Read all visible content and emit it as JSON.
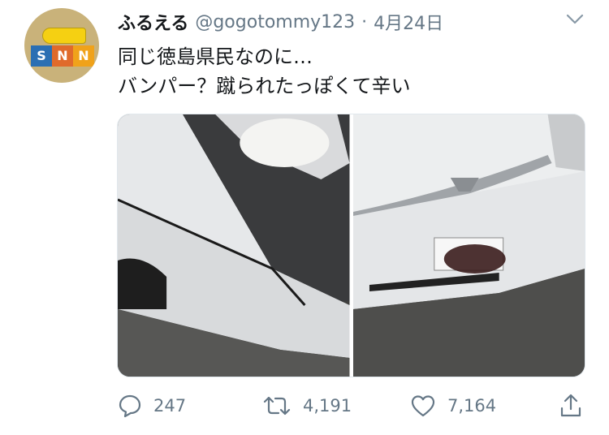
{
  "tweet": {
    "author_name": "ふるえる",
    "author_handle": "@gogotommy123",
    "separator": "·",
    "date": "4月24日",
    "text_lines": [
      "同じ徳島県民なのに…",
      "バンパー？蹴られたっぽくて辛い"
    ]
  },
  "avatar": {
    "letters": [
      "S",
      "N",
      "N"
    ]
  },
  "media": {
    "photos": [
      {
        "name": "photo-1",
        "subject": "car-bumper-left"
      },
      {
        "name": "photo-2",
        "subject": "car-front-grille"
      }
    ]
  },
  "actions": {
    "reply_count": "247",
    "retweet_count": "4,191",
    "like_count": "7,164"
  },
  "icons": [
    "chevron-down-icon",
    "reply-icon",
    "retweet-icon",
    "like-icon",
    "share-icon"
  ],
  "colors": {
    "text": "#14171a",
    "secondary": "#657786",
    "border": "#e1e8ed"
  }
}
